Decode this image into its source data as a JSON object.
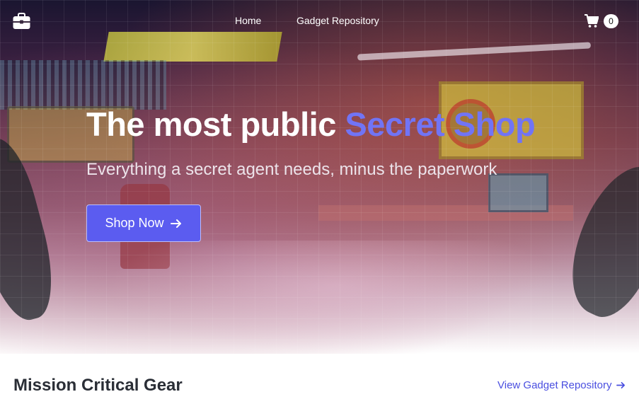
{
  "nav": {
    "logo_icon": "briefcase-icon",
    "links": [
      {
        "label": "Home"
      },
      {
        "label": "Gadget Repository"
      }
    ],
    "cart_icon": "shopping-cart-icon",
    "cart_count": "0"
  },
  "hero": {
    "title_plain": "The most public",
    "title_accent": "Secret Shop",
    "subtitle": "Everything a secret agent needs, minus the paperwork",
    "cta_label": "Shop Now",
    "cta_icon": "arrow-right-icon"
  },
  "section": {
    "title": "Mission Critical Gear",
    "link_label": "View Gadget Repository",
    "link_icon": "arrow-right-icon"
  },
  "colors": {
    "accent": "#7174f5",
    "button": "#5b5cf0",
    "link": "#4a4fe0"
  }
}
